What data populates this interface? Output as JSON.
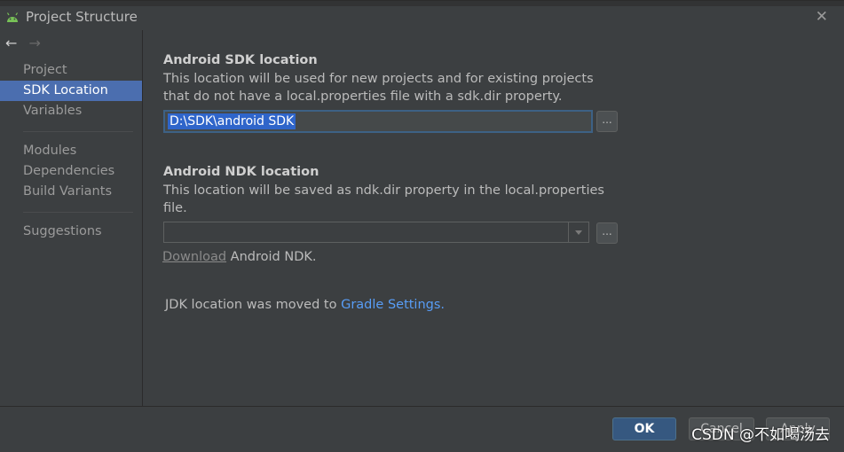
{
  "window": {
    "title": "Project Structure"
  },
  "sidebar": {
    "items": [
      {
        "label": "Project"
      },
      {
        "label": "SDK Location"
      },
      {
        "label": "Variables"
      },
      {
        "label": "Modules"
      },
      {
        "label": "Dependencies"
      },
      {
        "label": "Build Variants"
      },
      {
        "label": "Suggestions"
      }
    ]
  },
  "sdk": {
    "heading": "Android SDK location",
    "description_line1": "This location will be used for new projects and for existing projects",
    "description_line2": "that do not have a local.properties file with a sdk.dir property.",
    "value": "D:\\SDK\\android SDK",
    "browse_label": "..."
  },
  "ndk": {
    "heading": "Android NDK location",
    "description_line1": "This location will be saved as ndk.dir property in the local.properties",
    "description_line2": "file.",
    "value": "",
    "browse_label": "...",
    "download_link": "Download",
    "download_suffix": " Android NDK."
  },
  "jdk": {
    "text": "JDK location was moved to ",
    "link": "Gradle Settings."
  },
  "footer": {
    "ok_label": "OK",
    "cancel_label": "Cancel",
    "apply_label": "Apply"
  },
  "watermark": "CSDN @不如喝汤去",
  "colors": {
    "background": "#3c3f41",
    "selection": "#4b6eaf",
    "link": "#589df6",
    "ok_button": "#365880"
  }
}
